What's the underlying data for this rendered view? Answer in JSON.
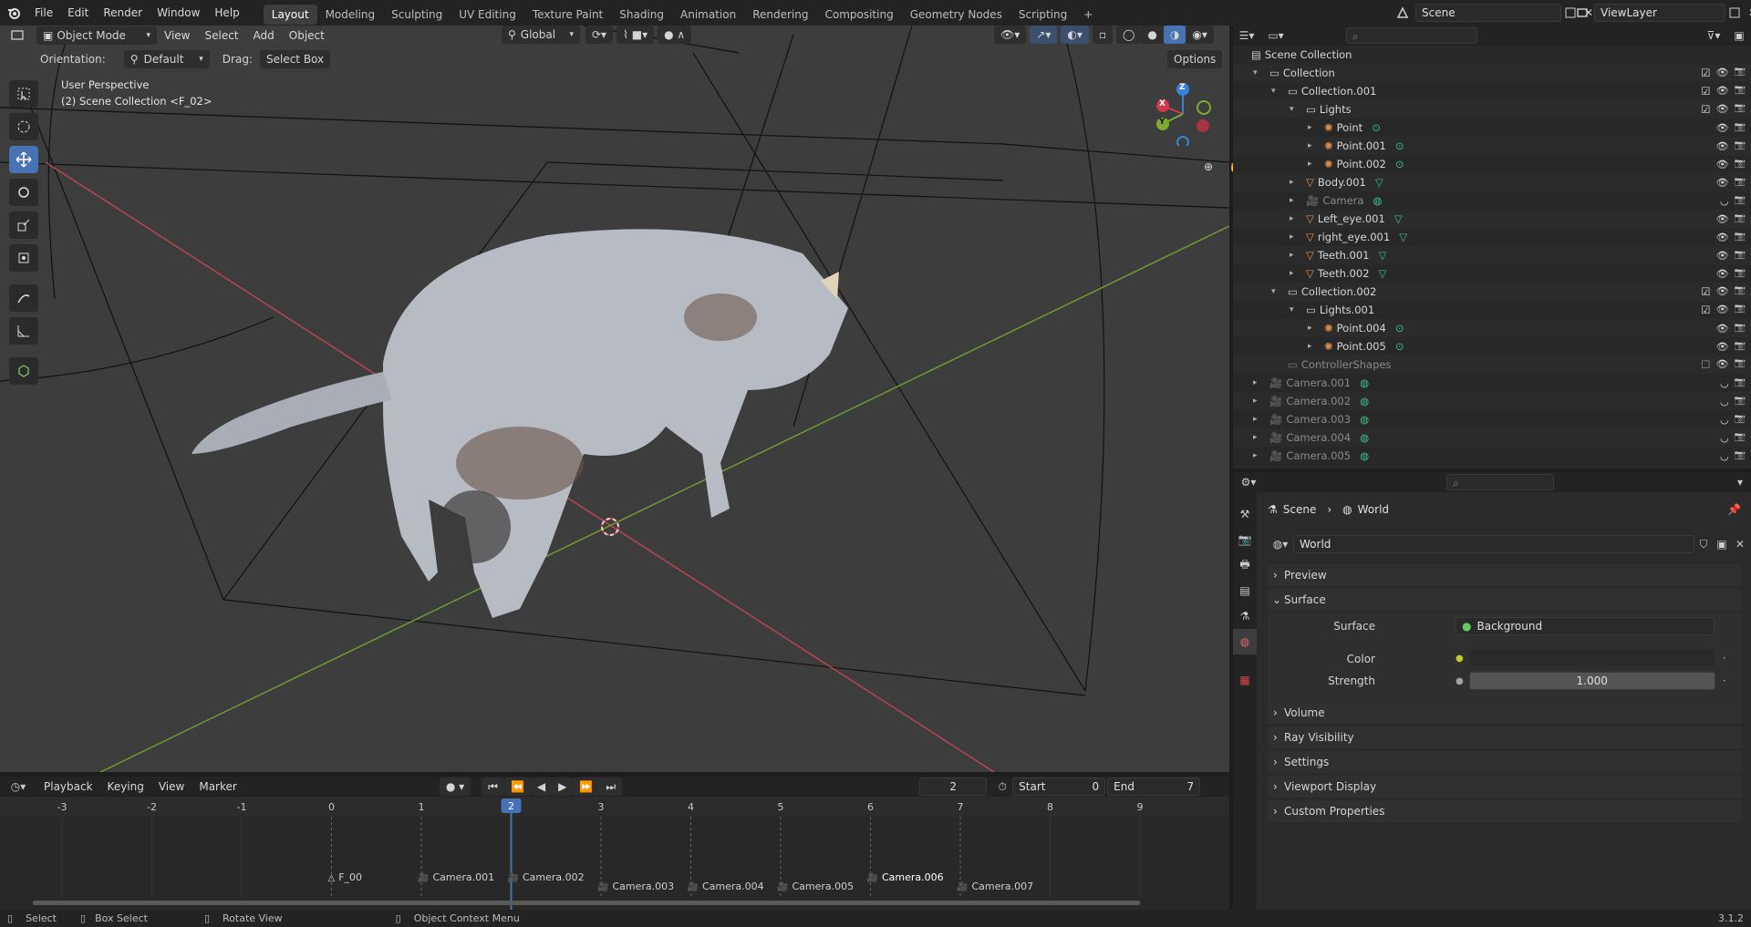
{
  "menubar": {
    "items": [
      "File",
      "Edit",
      "Render",
      "Window",
      "Help"
    ],
    "workspaces": [
      "Layout",
      "Modeling",
      "Sculpting",
      "UV Editing",
      "Texture Paint",
      "Shading",
      "Animation",
      "Rendering",
      "Compositing",
      "Geometry Nodes",
      "Scripting"
    ],
    "add_workspace": "+",
    "scene_label": "Scene",
    "view_layer_label": "ViewLayer"
  },
  "viewport": {
    "mode": "Object Mode",
    "menus": [
      "View",
      "Select",
      "Add",
      "Object"
    ],
    "transform_orientation": "Global",
    "orientation_label": "Orientation:",
    "orientation_value": "Default",
    "drag_label": "Drag:",
    "drag_value": "Select Box",
    "options_label": "Options",
    "perspective_text": "User Perspective",
    "collection_text": "(2) Scene Collection <F_02>",
    "gizmo_axes": {
      "x": "X",
      "y": "Y",
      "z": "Z"
    }
  },
  "outliner": {
    "root": "Scene Collection",
    "rows": [
      {
        "label": "Collection",
        "depth": 0,
        "type": "collection"
      },
      {
        "label": "Collection.001",
        "depth": 1,
        "type": "collection"
      },
      {
        "label": "Lights",
        "depth": 2,
        "type": "collection"
      },
      {
        "label": "Point",
        "depth": 3,
        "type": "light"
      },
      {
        "label": "Point.001",
        "depth": 3,
        "type": "light"
      },
      {
        "label": "Point.002",
        "depth": 3,
        "type": "light"
      },
      {
        "label": "Body.001",
        "depth": 2,
        "type": "mesh"
      },
      {
        "label": "Camera",
        "depth": 2,
        "type": "camera"
      },
      {
        "label": "Left_eye.001",
        "depth": 2,
        "type": "mesh"
      },
      {
        "label": "right_eye.001",
        "depth": 2,
        "type": "mesh"
      },
      {
        "label": "Teeth.001",
        "depth": 2,
        "type": "mesh"
      },
      {
        "label": "Teeth.002",
        "depth": 2,
        "type": "mesh"
      },
      {
        "label": "Collection.002",
        "depth": 1,
        "type": "collection"
      },
      {
        "label": "Lights.001",
        "depth": 2,
        "type": "collection"
      },
      {
        "label": "Point.004",
        "depth": 3,
        "type": "light"
      },
      {
        "label": "Point.005",
        "depth": 3,
        "type": "light"
      },
      {
        "label": "ControllerShapes",
        "depth": 1,
        "type": "collection-dim"
      },
      {
        "label": "Camera.001",
        "depth": 0,
        "type": "camera-root"
      },
      {
        "label": "Camera.002",
        "depth": 0,
        "type": "camera-root"
      },
      {
        "label": "Camera.003",
        "depth": 0,
        "type": "camera-root"
      },
      {
        "label": "Camera.004",
        "depth": 0,
        "type": "camera-root"
      },
      {
        "label": "Camera.005",
        "depth": 0,
        "type": "camera-root"
      }
    ]
  },
  "properties": {
    "breadcrumb": [
      "Scene",
      "World"
    ],
    "world_name": "World",
    "panels": {
      "preview": "Preview",
      "surface": "Surface",
      "volume": "Volume",
      "ray_visibility": "Ray Visibility",
      "settings": "Settings",
      "viewport_display": "Viewport Display",
      "custom_properties": "Custom Properties"
    },
    "surface_label": "Surface",
    "surface_value": "Background",
    "color_label": "Color",
    "strength_label": "Strength",
    "strength_value": "1.000"
  },
  "timeline": {
    "menus": [
      "Playback",
      "Keying",
      "View",
      "Marker"
    ],
    "current_frame": "2",
    "start_label": "Start",
    "start_value": "0",
    "end_label": "End",
    "end_value": "7",
    "ruler": [
      "-3",
      "-2",
      "-1",
      "0",
      "1",
      "2",
      "3",
      "4",
      "5",
      "6",
      "7",
      "8",
      "9"
    ],
    "markers": [
      "F_00",
      "Camera.001",
      "Camera.002",
      "Camera.003",
      "Camera.004",
      "Camera.005",
      "Camera.006",
      "Camera.007"
    ]
  },
  "statusbar": {
    "select": "Select",
    "box_select": "Box Select",
    "rotate_view": "Rotate View",
    "context_menu": "Object Context Menu",
    "version": "3.1.2"
  },
  "colors": {
    "accent": "#4772b3",
    "x_axis": "#d1394b",
    "y_axis": "#7dab2f",
    "z_axis": "#3a82d9"
  }
}
